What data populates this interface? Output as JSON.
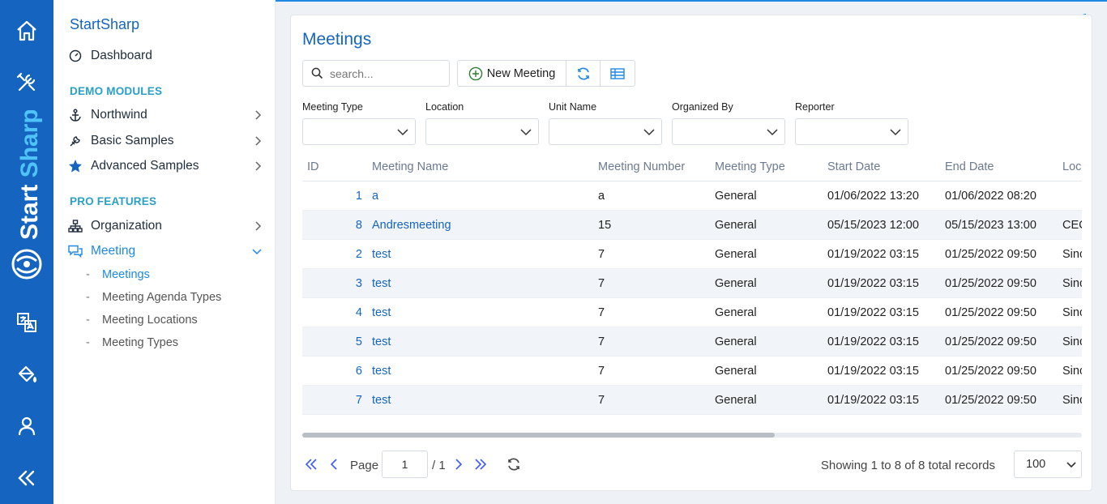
{
  "rail": {
    "brand": "StartSharp",
    "colors": {
      "background": "#1565c0",
      "brand_white": "#ffffff",
      "brand_light": "#4fc3f7"
    },
    "icons": [
      "home-icon",
      "tools-icon",
      "translate-icon",
      "paint-bucket-icon",
      "user-icon",
      "collapse-icon"
    ]
  },
  "sidebar": {
    "title": "StartSharp",
    "dashboard": "Dashboard",
    "sections": {
      "demo": "DEMO MODULES",
      "pro": "PRO FEATURES"
    },
    "demo_items": [
      "Northwind",
      "Basic Samples",
      "Advanced Samples"
    ],
    "pro_items": [
      "Organization",
      "Meeting"
    ],
    "meeting_subitems": [
      "Meetings",
      "Meeting Agenda Types",
      "Meeting Locations",
      "Meeting Types"
    ],
    "active_sub": "Meetings"
  },
  "page": {
    "title": "Meetings",
    "search_placeholder": "search...",
    "new_button": "New Meeting"
  },
  "filters": [
    "Meeting Type",
    "Location",
    "Unit Name",
    "Organized By",
    "Reporter"
  ],
  "grid": {
    "columns": [
      "ID",
      "Meeting Name",
      "Meeting Number",
      "Meeting Type",
      "Start Date",
      "End Date",
      "Loc"
    ],
    "rows": [
      {
        "id": "1",
        "name": "a",
        "number": "a",
        "type": "General",
        "start": "01/06/2022 13:20",
        "end": "01/06/2022 08:20",
        "loc": ""
      },
      {
        "id": "8",
        "name": "Andresmeeting",
        "number": "15",
        "type": "General",
        "start": "05/15/2023 12:00",
        "end": "05/15/2023 13:00",
        "loc": "CEC"
      },
      {
        "id": "2",
        "name": "test",
        "number": "7",
        "type": "General",
        "start": "01/19/2022 03:15",
        "end": "01/25/2022 09:50",
        "loc": "Sinc"
      },
      {
        "id": "3",
        "name": "test",
        "number": "7",
        "type": "General",
        "start": "01/19/2022 03:15",
        "end": "01/25/2022 09:50",
        "loc": "Sinc"
      },
      {
        "id": "4",
        "name": "test",
        "number": "7",
        "type": "General",
        "start": "01/19/2022 03:15",
        "end": "01/25/2022 09:50",
        "loc": "Sinc"
      },
      {
        "id": "5",
        "name": "test",
        "number": "7",
        "type": "General",
        "start": "01/19/2022 03:15",
        "end": "01/25/2022 09:50",
        "loc": "Sinc"
      },
      {
        "id": "6",
        "name": "test",
        "number": "7",
        "type": "General",
        "start": "01/19/2022 03:15",
        "end": "01/25/2022 09:50",
        "loc": "Sinc"
      },
      {
        "id": "7",
        "name": "test",
        "number": "7",
        "type": "General",
        "start": "01/19/2022 03:15",
        "end": "01/25/2022 09:50",
        "loc": "Sinc"
      }
    ]
  },
  "pager": {
    "page_label": "Page",
    "page_value": "1",
    "total_pages": "/ 1",
    "status": "Showing 1 to 8 of 8 total records",
    "page_size": "100"
  }
}
